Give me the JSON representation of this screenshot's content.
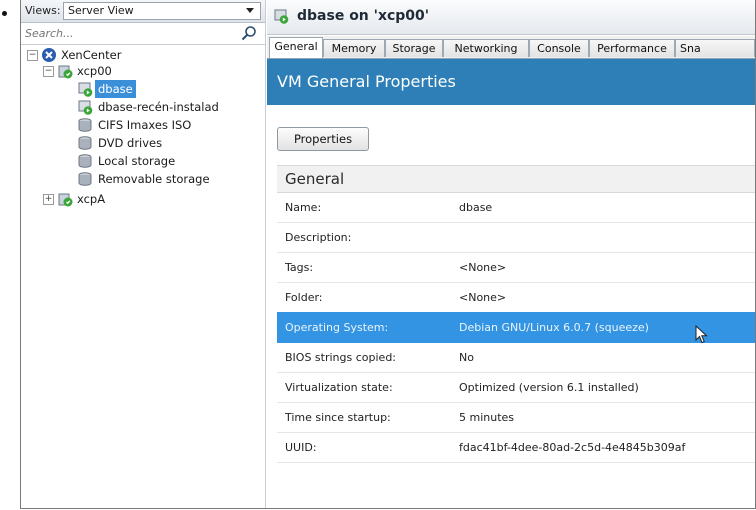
{
  "left": {
    "views_label": "Views:",
    "views_value": "Server View",
    "search_placeholder": "Search...",
    "tree": [
      {
        "label": "XenCenter",
        "icon": "xencenter-icon",
        "expander": "−"
      },
      {
        "label": "xcp00",
        "icon": "server-icon",
        "expander": "−"
      },
      {
        "label": "dbase",
        "icon": "vm-running-icon",
        "selected": true
      },
      {
        "label": "dbase-recén-instalad",
        "icon": "vm-running-icon"
      },
      {
        "label": "CIFS Imaxes ISO",
        "icon": "storage-icon"
      },
      {
        "label": "DVD drives",
        "icon": "storage-icon"
      },
      {
        "label": "Local storage",
        "icon": "storage-icon"
      },
      {
        "label": "Removable storage",
        "icon": "storage-icon"
      },
      {
        "label": "xcpA",
        "icon": "server-icon",
        "expander": "+"
      }
    ]
  },
  "right": {
    "title": "dbase on 'xcp00'",
    "tabs": [
      "General",
      "Memory",
      "Storage",
      "Networking",
      "Console",
      "Performance",
      "Sna"
    ],
    "active_tab": "General",
    "header": "VM General Properties",
    "properties_button": "Properties",
    "section_title": "General",
    "rows": [
      {
        "key": "Name:",
        "value": "dbase"
      },
      {
        "key": "Description:",
        "value": ""
      },
      {
        "key": "Tags:",
        "value": "<None>"
      },
      {
        "key": "Folder:",
        "value": "<None>"
      },
      {
        "key": "Operating System:",
        "value": "Debian GNU/Linux 6.0.7 (squeeze)",
        "highlighted": true
      },
      {
        "key": "BIOS strings copied:",
        "value": "No"
      },
      {
        "key": "Virtualization state:",
        "value": "Optimized (version 6.1 installed)"
      },
      {
        "key": "Time since startup:",
        "value": "5 minutes"
      },
      {
        "key": "UUID:",
        "value": "fdac41bf-4dee-80ad-2c5d-4e4845b309af"
      }
    ]
  },
  "colors": {
    "header_band": "#2e7fb8",
    "highlight_row": "#3294e3",
    "selection": "#3b8fd8",
    "vm_running": "#3aa63a"
  }
}
